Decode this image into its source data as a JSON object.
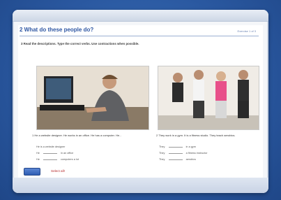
{
  "header": {
    "title": "2  What do these people do?",
    "page_label": "Exercise 1 of 3"
  },
  "instruction": "3  Read the descriptions. Type the correct verbs. Use contractions when possible.",
  "photos": {
    "left": {
      "caption": "1  He a website designer. He works in an office. He has a computer. He..."
    },
    "right": {
      "caption": "2  They work in a gym. It is a fitness studio. They teach aerobics."
    }
  },
  "exercise_left": {
    "rows": [
      {
        "label": "He is a website designer"
      },
      {
        "label": "He",
        "suffix": "in an office"
      },
      {
        "label": "He",
        "suffix": "computers a lot"
      }
    ]
  },
  "exercise_right": {
    "rows": [
      {
        "label": "They",
        "suffix": "in a gym"
      },
      {
        "label": "They",
        "suffix": "a fitness instructor"
      },
      {
        "label": "They",
        "suffix": "aerobics"
      }
    ]
  },
  "footer": {
    "check_label": "",
    "status": "Select all!"
  },
  "colors": {
    "title_blue": "#2f57a3",
    "status_red": "#b5282b",
    "background_blue": "#2a58a0"
  }
}
